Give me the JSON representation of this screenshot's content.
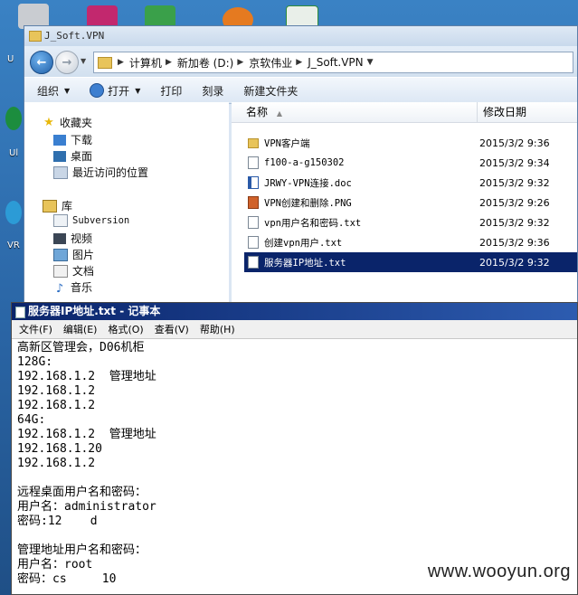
{
  "desktop": {
    "labels": [
      "U",
      "Ul",
      "VR"
    ]
  },
  "explorer": {
    "title": "J_Soft.VPN",
    "breadcrumb": [
      "计算机",
      "新加卷 (D:)",
      "京软伟业",
      "J_Soft.VPN"
    ],
    "toolbar": {
      "organize": "组织",
      "open": "打开",
      "print": "打印",
      "burn": "刻录",
      "new_folder": "新建文件夹"
    },
    "nav": {
      "favorites": "收藏夹",
      "downloads": "下载",
      "desktop": "桌面",
      "recent": "最近访问的位置",
      "libraries": "库",
      "subversion": "Subversion",
      "video": "视频",
      "pictures": "图片",
      "documents": "文档",
      "music": "音乐"
    },
    "columns": {
      "name": "名称",
      "date": "修改日期"
    },
    "files": [
      {
        "name": "VPN客户端",
        "date": "2015/3/2 9:36"
      },
      {
        "name": "f100-a-g150302",
        "date": "2015/3/2 9:34"
      },
      {
        "name": "JRWY-VPN连接.doc",
        "date": "2015/3/2 9:32"
      },
      {
        "name": "VPN创建和删除.PNG",
        "date": "2015/3/2 9:26"
      },
      {
        "name": "vpn用户名和密码.txt",
        "date": "2015/3/2 9:32"
      },
      {
        "name": "创建vpn用户.txt",
        "date": "2015/3/2 9:36"
      },
      {
        "name": "服务器IP地址.txt",
        "date": "2015/3/2 9:32"
      }
    ]
  },
  "notepad": {
    "title": "服务器IP地址.txt - 记事本",
    "menu": [
      "文件(F)",
      "编辑(E)",
      "格式(O)",
      "查看(V)",
      "帮助(H)"
    ],
    "lines": [
      "高新区管理会，D06机柜",
      "128G:",
      "192.168.1.2  管理地址",
      "192.168.1.2",
      "192.168.1.2",
      "64G:",
      "192.168.1.2  管理地址",
      "192.168.1.20",
      "192.168.1.2",
      "",
      "远程桌面用户名和密码：",
      "用户名：administrator",
      "密码:12    d",
      "",
      "管理地址用户名和密码：",
      "用户名：root",
      "密码：cs     10"
    ]
  },
  "watermark": "www.wooyun.org"
}
